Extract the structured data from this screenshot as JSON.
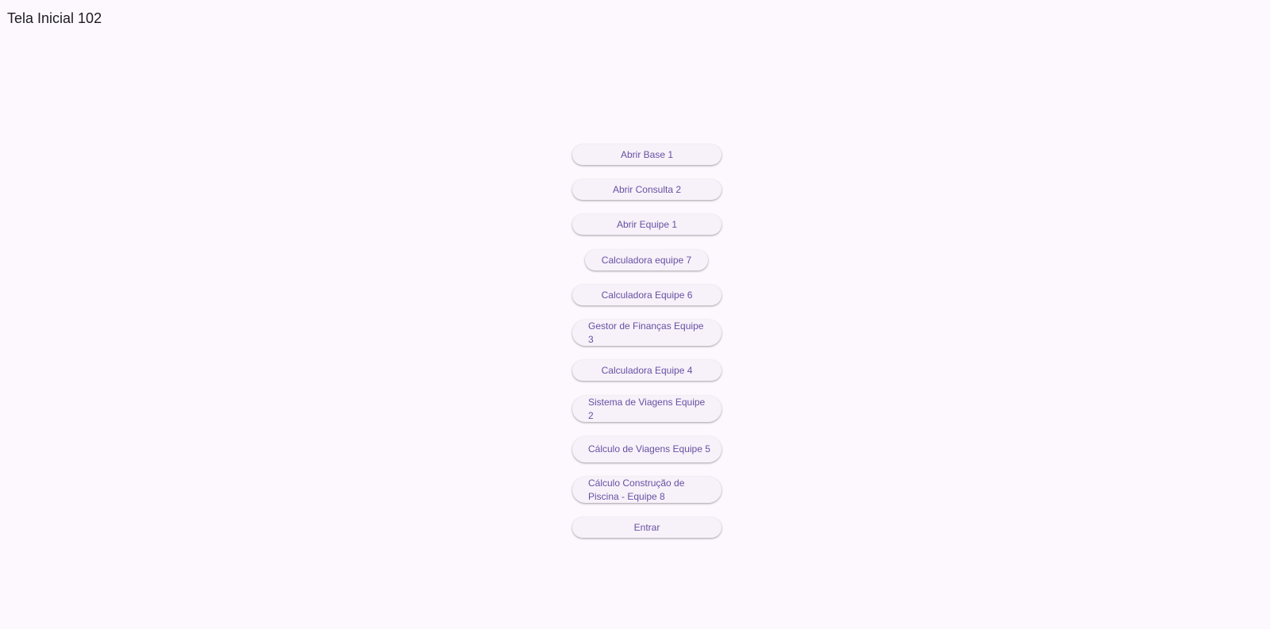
{
  "app_title": "Tela Inicial 102",
  "buttons": {
    "abrir_base_1": "Abrir Base 1",
    "abrir_consulta_2": "Abrir Consulta 2",
    "abrir_equipe_1": "Abrir Equipe 1",
    "calculadora_equipe_7": "Calculadora equipe 7",
    "calculadora_equipe_6": "Calculadora Equipe 6",
    "gestor_financas_equipe_3": "Gestor de Finanças Equipe 3",
    "calculadora_equipe_4": "Calculadora Equipe 4",
    "sistema_viagens_equipe_2": "Sistema de Viagens Equipe 2",
    "calculo_viagens_equipe_5": "Cálculo de Viagens Equipe 5",
    "calculo_piscina_equipe_8": "Cálculo Construção de Piscina - Equipe 8",
    "entrar": "Entrar"
  },
  "colors": {
    "background": "#fdf7fe",
    "button_surface": "#f7f2f9",
    "button_text": "#6750a4",
    "title_text": "#1d1b20"
  }
}
